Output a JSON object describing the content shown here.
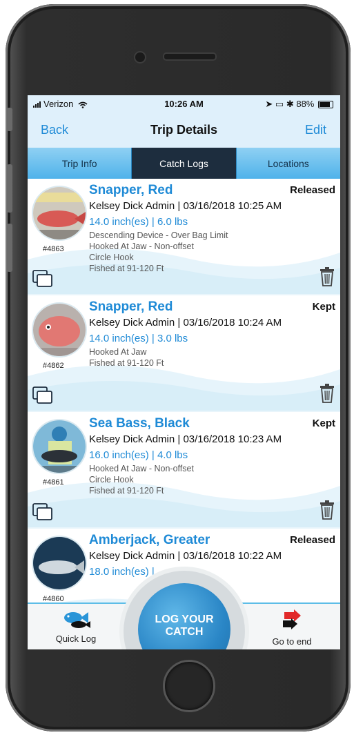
{
  "status_bar": {
    "carrier": "Verizon",
    "time": "10:26 AM",
    "battery": "88%"
  },
  "nav": {
    "back_label": "Back",
    "title": "Trip Details",
    "edit_label": "Edit"
  },
  "segments": {
    "items": [
      "Trip Info",
      "Catch Logs",
      "Locations"
    ],
    "active": "Catch Logs"
  },
  "catches": [
    {
      "species": "Snapper, Red",
      "disposition": "Released",
      "angler_date": "Kelsey Dick Admin | 03/16/2018 10:25 AM",
      "measure": "14.0 inch(es) | 6.0 lbs",
      "details": [
        "Descending Device -  Over Bag Limit",
        "Hooked At Jaw - Non-offset",
        "Circle Hook",
        "Fished at 91-120 Ft"
      ],
      "log_no": "#4863"
    },
    {
      "species": "Snapper, Red",
      "disposition": "Kept",
      "angler_date": "Kelsey Dick Admin | 03/16/2018 10:24 AM",
      "measure": "14.0 inch(es) | 3.0 lbs",
      "details": [
        "Hooked At Jaw",
        "Fished at 91-120 Ft"
      ],
      "log_no": "#4862"
    },
    {
      "species": "Sea Bass, Black",
      "disposition": "Kept",
      "angler_date": "Kelsey Dick Admin | 03/16/2018 10:23 AM",
      "measure": "16.0 inch(es) | 4.0 lbs",
      "details": [
        "Hooked At Jaw - Non-offset",
        "Circle Hook",
        "Fished at 91-120 Ft"
      ],
      "log_no": "#4861"
    },
    {
      "species": "Amberjack, Greater",
      "disposition": "Released",
      "angler_date": "Kelsey Dick Admin | 03/16/2018 10:22 AM",
      "measure": "18.0 inch(es) | ",
      "details": [],
      "log_no": "#4860"
    }
  ],
  "tab_bar": {
    "quick_log_label": "Quick Log",
    "log_catch_line1": "LOG YOUR",
    "log_catch_line2": "CATCH",
    "go_to_end_label": "Go to end"
  },
  "colors": {
    "accent_blue": "#1e8ad6",
    "segment_active": "#1d2d3e",
    "segment_bg": "#5ab7ec"
  }
}
